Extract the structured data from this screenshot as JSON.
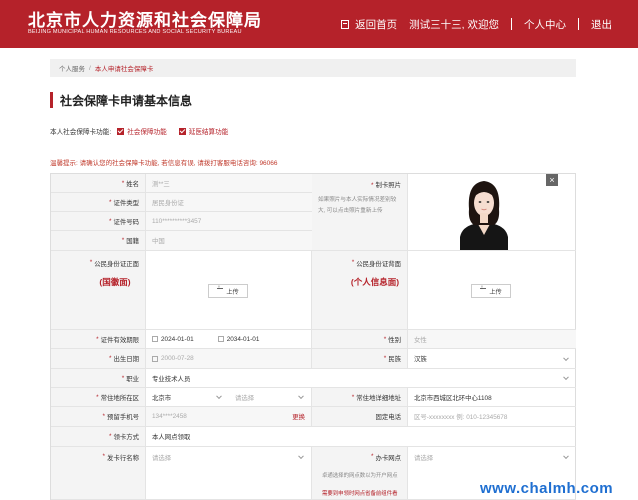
{
  "header": {
    "title": "北京市人力资源和社会保障局",
    "subtitle": "BEIJING MUNICIPAL HUMAN RESOURCES AND SOCIAL SECURITY BUREAU",
    "home_label": "返回首页",
    "welcome": "测试三十三, 欢迎您",
    "personal_center": "个人中心",
    "logout": "退出"
  },
  "breadcrumb": {
    "root": "个人服务",
    "separator": "/",
    "current": "本人申请社会保障卡"
  },
  "section_title": "社会保障卡申请基本信息",
  "card_function": {
    "label": "本人社会保障卡功能:",
    "options": [
      "社会保障功能",
      "延医结算功能"
    ]
  },
  "tip": "温馨提示: 请确认您的社会保障卡功能, 若信息有误, 请拨打客服电话咨询: 96066",
  "form": {
    "name": {
      "label": "姓名",
      "value": "测**三"
    },
    "id_type": {
      "label": "证件类型",
      "value": "居民身份证"
    },
    "id_number": {
      "label": "证件号码",
      "value": "110**********3457"
    },
    "nationality": {
      "label": "国籍",
      "value": "中国"
    },
    "card_photo": {
      "label": "制卡照片",
      "hint": "如果照片与本人实际情况差别较大, 可以点击照片重新上传"
    },
    "id_front": {
      "label": "公民身份证正面",
      "side": "(国徽面)",
      "upload": "上传"
    },
    "id_back": {
      "label": "公民身份证背面",
      "side": "(个人信息面)",
      "upload": "上传"
    },
    "validity": {
      "label": "证件有效期限",
      "start": "2024-01-01",
      "end": "2034-01-01"
    },
    "gender": {
      "label": "性别",
      "value": "女性"
    },
    "birth_date": {
      "label": "出生日期",
      "value": "2000-07-28"
    },
    "ethnicity": {
      "label": "民族",
      "value": "汉族"
    },
    "occupation": {
      "label": "职业",
      "value": "专业技术人员"
    },
    "residence_area": {
      "label": "常住地所在区",
      "value": "北京市",
      "placeholder": "请选择"
    },
    "residence_address": {
      "label": "常住地详细地址",
      "value": "北京市西城区北环中心1108"
    },
    "phone": {
      "label": "预留手机号",
      "value": "134****2458",
      "change": "更换"
    },
    "landline": {
      "label": "固定电话",
      "placeholder": "区号-xxxxxxxx 例: 010-12345678"
    },
    "pickup": {
      "label": "领卡方式",
      "value": "本人网点领取"
    },
    "issuing_bank": {
      "label": "发卡行名称",
      "placeholder": "请选择"
    },
    "service_point": {
      "label": "办卡网点",
      "placeholder": "请选择",
      "hint": "卓通选择的网点数以为开户网点",
      "note": "需要到申领时网点省备前组件看"
    }
  },
  "watermark": "www.chalmh.com",
  "colors": {
    "brand": "#b5222a",
    "label_bg": "#f4f4f4"
  }
}
